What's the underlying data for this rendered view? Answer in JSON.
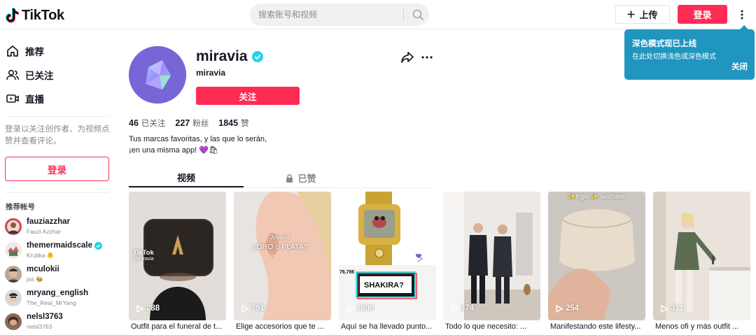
{
  "header": {
    "logo_text": "TikTok",
    "search_placeholder": "搜索账号和视频",
    "upload_label": "上传",
    "login_label": "登录"
  },
  "tooltip": {
    "title": "深色模式现已上线",
    "body": "在此处切换浅色或深色模式",
    "close_label": "关闭"
  },
  "sidebar": {
    "nav": [
      {
        "label": "推荐",
        "icon": "home-icon"
      },
      {
        "label": "已关注",
        "icon": "following-icon"
      },
      {
        "label": "直播",
        "icon": "live-icon"
      }
    ],
    "login_hint": "登录以关注创作者、为视频点赞并查看评论。",
    "login_button": "登录",
    "suggested_heading": "推荐帐号",
    "accounts": [
      {
        "name": "fauziazzhar",
        "sub": "Fauzi Azzhar",
        "verified": false
      },
      {
        "name": "themermaidscale",
        "sub": "Krutika 🐥",
        "verified": true
      },
      {
        "name": "mculokii",
        "sub": "jas 🐝",
        "verified": false
      },
      {
        "name": "mryang_english",
        "sub": "The_Real_MrYang",
        "verified": false
      },
      {
        "name": "nelsl3763",
        "sub": "nelsl3763",
        "verified": false
      }
    ]
  },
  "profile": {
    "username": "miravia",
    "display_name": "miravia",
    "follow_label": "关注",
    "stats": [
      {
        "value": "46",
        "label": "已关注"
      },
      {
        "value": "227",
        "label": "粉丝"
      },
      {
        "value": "1845",
        "label": "赞"
      }
    ],
    "bio_line1": "Tus marcas favoritas, y las que lo serán,",
    "bio_line2": "¡en una misma app! 💜🛍"
  },
  "tabs": {
    "videos": "视频",
    "liked": "已赞"
  },
  "videos": [
    {
      "views": "288",
      "caption": "Outfit para el funeral de t...",
      "overlay": "TikTok",
      "overlay2": "@miravia"
    },
    {
      "views": "751",
      "caption": "Elige accesorios que te ...",
      "overlay": "Joyería",
      "overlay2": "¿ORO o PLATA?"
    },
    {
      "views": "1896",
      "caption": "Aquí se ha llevado punto...",
      "overlay": "SHAKIRA?",
      "overlay2": "76,78€"
    },
    {
      "views": "374",
      "caption": "Todo lo que necesito: ...",
      "overlay": "",
      "overlay2": ""
    },
    {
      "views": "254",
      "caption": "Manifestando este lifesty...",
      "overlay": "✨it girl ✨ aesthetic",
      "overlay2": ""
    },
    {
      "views": "311",
      "caption": "Menos ofi y más outfit ...",
      "overlay": "",
      "overlay2": ""
    }
  ],
  "colors": {
    "brand": "#fe2c55",
    "tooltip_bg": "#1f95bf",
    "verified": "#20d5ec"
  }
}
